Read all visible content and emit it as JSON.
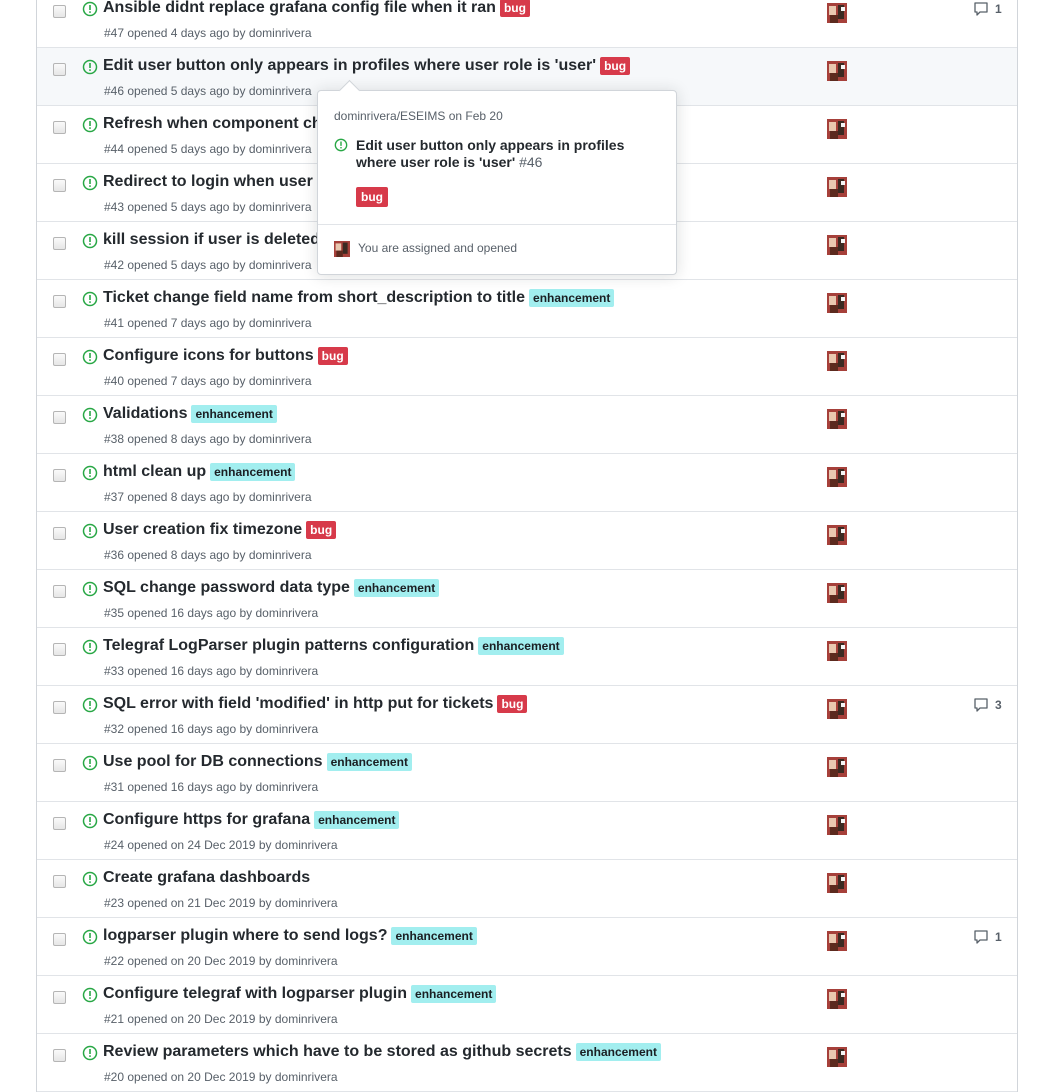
{
  "colors": {
    "open": "#28a745",
    "bug": "#d73a4a",
    "enhancement": "#a2eeef"
  },
  "issues": [
    {
      "title": "Ansible didnt replace grafana config file when it ran",
      "label": "bug",
      "number": "#47",
      "opened": "opened 4 days ago by",
      "author": "dominrivera",
      "comments": "1"
    },
    {
      "title": "Edit user button only appears in profiles where user role is 'user'",
      "label": "bug",
      "number": "#46",
      "opened": "opened 5 days ago by",
      "author": "dominrivera",
      "comments": "",
      "hover": true
    },
    {
      "title": "Refresh when component changes",
      "label": "",
      "number": "#44",
      "opened": "opened 5 days ago by",
      "author": "dominrivera",
      "comments": ""
    },
    {
      "title": "Redirect to login when user session expires",
      "label": "",
      "number": "#43",
      "opened": "opened 5 days ago by",
      "author": "dominrivera",
      "comments": ""
    },
    {
      "title": "kill session if user is deleted",
      "label": "",
      "number": "#42",
      "opened": "opened 5 days ago by",
      "author": "dominrivera",
      "comments": ""
    },
    {
      "title": "Ticket change field name from short_description to title",
      "label": "enhancement",
      "number": "#41",
      "opened": "opened 7 days ago by",
      "author": "dominrivera",
      "comments": ""
    },
    {
      "title": "Configure icons for buttons",
      "label": "bug",
      "number": "#40",
      "opened": "opened 7 days ago by",
      "author": "dominrivera",
      "comments": ""
    },
    {
      "title": "Validations",
      "label": "enhancement",
      "number": "#38",
      "opened": "opened 8 days ago by",
      "author": "dominrivera",
      "comments": ""
    },
    {
      "title": "html clean up",
      "label": "enhancement",
      "number": "#37",
      "opened": "opened 8 days ago by",
      "author": "dominrivera",
      "comments": ""
    },
    {
      "title": "User creation fix timezone",
      "label": "bug",
      "number": "#36",
      "opened": "opened 8 days ago by",
      "author": "dominrivera",
      "comments": ""
    },
    {
      "title": "SQL change password data type",
      "label": "enhancement",
      "number": "#35",
      "opened": "opened 16 days ago by",
      "author": "dominrivera",
      "comments": ""
    },
    {
      "title": "Telegraf LogParser plugin patterns configuration",
      "label": "enhancement",
      "number": "#33",
      "opened": "opened 16 days ago by",
      "author": "dominrivera",
      "comments": ""
    },
    {
      "title": "SQL error with field 'modified' in http put for tickets",
      "label": "bug",
      "number": "#32",
      "opened": "opened 16 days ago by",
      "author": "dominrivera",
      "comments": "3"
    },
    {
      "title": "Use pool for DB connections",
      "label": "enhancement",
      "number": "#31",
      "opened": "opened 16 days ago by",
      "author": "dominrivera",
      "comments": ""
    },
    {
      "title": "Configure https for grafana",
      "label": "enhancement",
      "number": "#24",
      "opened": "opened on 24 Dec 2019 by",
      "author": "dominrivera",
      "comments": ""
    },
    {
      "title": "Create grafana dashboards",
      "label": "",
      "number": "#23",
      "opened": "opened on 21 Dec 2019 by",
      "author": "dominrivera",
      "comments": ""
    },
    {
      "title": "logparser plugin where to send logs?",
      "label": "enhancement",
      "number": "#22",
      "opened": "opened on 20 Dec 2019 by",
      "author": "dominrivera",
      "comments": "1"
    },
    {
      "title": "Configure telegraf with logparser plugin",
      "label": "enhancement",
      "number": "#21",
      "opened": "opened on 20 Dec 2019 by",
      "author": "dominrivera",
      "comments": ""
    },
    {
      "title": "Review parameters which have to be stored as github secrets",
      "label": "enhancement",
      "number": "#20",
      "opened": "opened on 20 Dec 2019 by",
      "author": "dominrivera",
      "comments": ""
    }
  ],
  "popover": {
    "repo": "dominrivera/ESEIMS",
    "date": "on Feb 20",
    "title": "Edit user button only appears in profiles where user role is 'user'",
    "number": "#46",
    "label": "bug",
    "footer": "You are assigned and opened"
  }
}
